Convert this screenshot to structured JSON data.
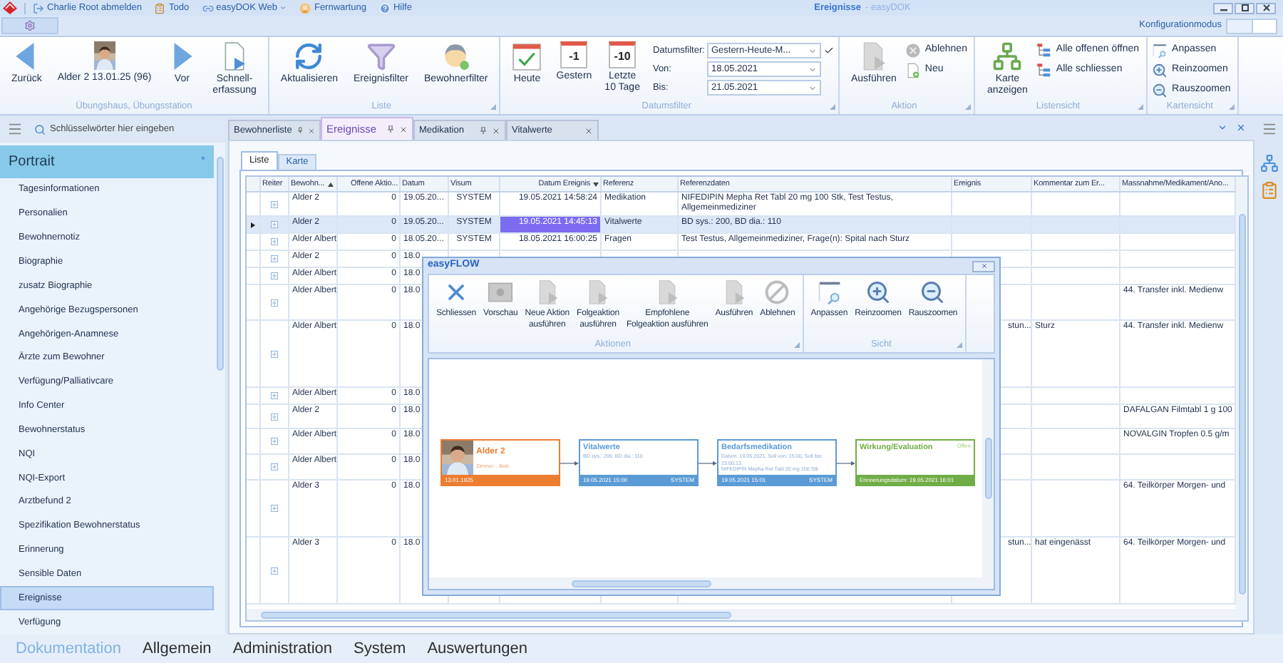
{
  "window": {
    "title": "Ereignisse",
    "subtitle": "- easyDOK"
  },
  "quick_access": [
    {
      "label": "Charlie Root abmelden",
      "kind": "logout",
      "dropdown": false
    },
    {
      "label": "Todo",
      "kind": "todo",
      "dropdown": false
    },
    {
      "label": "easyDOK Web",
      "kind": "link",
      "dropdown": true
    },
    {
      "label": "Fernwartung",
      "kind": "support",
      "dropdown": false
    },
    {
      "label": "Hilfe",
      "kind": "help",
      "dropdown": false
    }
  ],
  "config_mode": {
    "label": "Konfigurationmodus",
    "on": false
  },
  "ribbon": [
    {
      "label": "Übungshaus, Übungsstation",
      "launcher": false,
      "buttons": [
        {
          "lines": [
            "Zurück"
          ],
          "kind": "back"
        },
        {
          "lines": [
            "Alder 2 13.01.25 (96)"
          ]
        },
        {
          "lines": [
            "Vor"
          ],
          "kind": "forward"
        },
        {
          "lines": [
            "Schnell-",
            "erfassung"
          ],
          "kind": "quickentry"
        }
      ]
    },
    {
      "label": "Liste",
      "launcher": true,
      "buttons": [
        {
          "lines": [
            "Aktualisieren"
          ],
          "kind": "refresh"
        },
        {
          "lines": [
            "Ereignisfilter"
          ],
          "kind": "filter"
        },
        {
          "lines": [
            "Bewohnerfilter"
          ],
          "kind": "person"
        }
      ]
    },
    {
      "label": "Datumsfilter",
      "launcher": true,
      "buttons": [
        {
          "lines": [
            "Heute"
          ],
          "kind": "today"
        },
        {
          "lines": [
            "Gestern"
          ],
          "kind": "calendar",
          "badge": "-1"
        },
        {
          "lines": [
            "Letzte",
            "10 Tage"
          ],
          "kind": "calendar",
          "badge": "-10"
        }
      ],
      "fields": [
        {
          "label": "Datumsfilter:",
          "value": "Gestern-Heute-M...",
          "kind": "filter"
        },
        {
          "label": "Von:",
          "value": "18.05.2021",
          "kind": "date"
        },
        {
          "label": "Bis:",
          "value": "21.05.2021",
          "kind": "date"
        }
      ]
    },
    {
      "label": "Aktion",
      "launcher": true,
      "buttons": [
        {
          "lines": [
            "Ausführen"
          ],
          "kind": "doc-play"
        }
      ],
      "small_buttons": [
        {
          "label": "Ablehnen",
          "kind": "reject"
        },
        {
          "label": "Neu",
          "kind": "new"
        }
      ]
    },
    {
      "label": "Listensicht",
      "launcher": true,
      "buttons": [
        {
          "lines": [
            "Karte",
            "anzeigen"
          ],
          "kind": "map"
        }
      ],
      "small_buttons": [
        {
          "label": "Alle offenen öffnen",
          "kind": "expand-all"
        },
        {
          "label": "Alle schliessen",
          "kind": "collapse-all"
        }
      ]
    },
    {
      "label": "Kartensicht",
      "launcher": true,
      "small_buttons": [
        {
          "label": "Anpassen",
          "kind": "fit"
        },
        {
          "label": "Reinzoomen",
          "kind": "zoomin"
        },
        {
          "label": "Rauszoomen",
          "kind": "zoomout"
        }
      ]
    }
  ],
  "sidebar": {
    "search_placeholder": "Schlüsselwörter hier eingeben",
    "header": "Portrait",
    "header_mark": "*",
    "items": [
      {
        "label": "Tagesinformationen",
        "selected": false
      },
      {
        "label": "Personalien",
        "selected": false
      },
      {
        "label": "Bewohnernotiz",
        "selected": false
      },
      {
        "label": "Biographie",
        "selected": false
      },
      {
        "label": "zusatz Biographie",
        "selected": false
      },
      {
        "label": "Angehörige Bezugspersonen",
        "selected": false
      },
      {
        "label": "Angehörigen-Anamnese",
        "selected": false
      },
      {
        "label": "Ärzte zum Bewohner",
        "selected": false
      },
      {
        "label": "Verfügung/Palliativcare",
        "selected": false
      },
      {
        "label": "Info Center",
        "selected": false
      },
      {
        "label": "Bewohnerstatus",
        "selected": false
      },
      {
        "label": "NQI",
        "selected": false
      },
      {
        "label": "NQI-Export",
        "selected": false
      },
      {
        "label": "Arztbefund 2",
        "selected": false
      },
      {
        "label": "Spezifikation Bewohnerstatus",
        "selected": false
      },
      {
        "label": "Erinnerung",
        "selected": false
      },
      {
        "label": "Sensible Daten",
        "selected": false
      },
      {
        "label": "Ereignisse",
        "selected": true
      },
      {
        "label": "Verfügung",
        "selected": false
      }
    ]
  },
  "doc_tabs": [
    {
      "label": "Bewohnerliste",
      "selected": false,
      "pinned": true
    },
    {
      "label": "Ereignisse",
      "selected": true,
      "pinned": true
    },
    {
      "label": "Medikation",
      "selected": false,
      "pinned": true
    },
    {
      "label": "Vitalwerte",
      "selected": false,
      "pinned": false
    }
  ],
  "view_tabs": [
    {
      "label": "Liste",
      "selected": true
    },
    {
      "label": "Karte",
      "selected": false
    }
  ],
  "table": {
    "columns": [
      {
        "label": "Reiter",
        "sorted_ascending": false,
        "sorted_descending": false,
        "focused": false
      },
      {
        "label": "Bewohn...",
        "sorted_ascending": true,
        "sorted_descending": false,
        "focused": false
      },
      {
        "label": "Offene Aktio...",
        "sorted_ascending": false,
        "sorted_descending": false,
        "focused": false
      },
      {
        "label": "Datum",
        "sorted_ascending": false,
        "sorted_descending": false,
        "focused": false
      },
      {
        "label": "Visum",
        "sorted_ascending": false,
        "sorted_descending": false,
        "focused": false
      },
      {
        "label": "Datum Ereignis",
        "sorted_ascending": false,
        "sorted_descending": true,
        "focused": true
      },
      {
        "label": "Referenz",
        "sorted_ascending": false,
        "sorted_descending": false,
        "focused": false
      },
      {
        "label": "Referenzdaten",
        "sorted_ascending": false,
        "sorted_descending": false,
        "focused": false
      },
      {
        "label": "Ereignis",
        "sorted_ascending": false,
        "sorted_descending": false,
        "focused": false
      },
      {
        "label": "Kommentar zum Er...",
        "sorted_ascending": false,
        "sorted_descending": false,
        "focused": false
      },
      {
        "label": "Massnahme/Medikament/Ano...",
        "sorted_ascending": false,
        "sorted_descending": false,
        "focused": false
      }
    ],
    "rows": [
      {
        "selected": false,
        "cells": [
          "",
          "Alder 2",
          "0",
          "19.05.20...",
          "SYSTEM",
          "19.05.2021 14:58:24",
          "Medikation",
          "NIFEDIPIN Mepha Ret Tabl 20 mg 100 Stk, Test Testus, Allgemeinmediziner",
          "",
          "",
          ""
        ]
      },
      {
        "selected": true,
        "cells": [
          "",
          "Alder 2",
          "0",
          "19.05.20...",
          "SYSTEM",
          "19.05.2021 14:45:13",
          "Vitalwerte",
          "BD sys.: 200, BD dia.: 110",
          "",
          "",
          ""
        ]
      },
      {
        "selected": false,
        "cells": [
          "",
          "Alder Albert",
          "0",
          "18.05.20...",
          "SYSTEM",
          "18.05.2021 16:00:25",
          "Fragen",
          "Test Testus, Allgemeinmediziner, Frage(n): Spital nach Sturz",
          "",
          "",
          ""
        ]
      },
      {
        "selected": false,
        "cells": [
          "",
          "Alder 2",
          "0",
          "18.0",
          "",
          "",
          "",
          "",
          "",
          "",
          ""
        ]
      },
      {
        "selected": false,
        "cells": [
          "",
          "Alder Albert",
          "0",
          "18.0",
          "",
          "",
          "",
          "",
          "",
          "",
          ""
        ]
      },
      {
        "selected": false,
        "cells": [
          "",
          "Alder Albert",
          "0",
          "18.0",
          "",
          "",
          "",
          "",
          "",
          "",
          "44. Transfer inkl. Medienw"
        ]
      },
      {
        "selected": false,
        "cells": [
          "",
          "Alder Albert",
          "0",
          "18.0",
          "",
          "",
          "",
          "",
          "stun...",
          "Sturz",
          "44. Transfer inkl. Medienw"
        ]
      },
      {
        "selected": false,
        "cells": [
          "",
          "Alder Albert",
          "0",
          "18.0",
          "",
          "",
          "",
          "",
          "",
          "",
          ""
        ]
      },
      {
        "selected": false,
        "cells": [
          "",
          "Alder 2",
          "0",
          "18.0",
          "",
          "",
          "",
          "",
          "",
          "",
          "DAFALGAN Filmtabl 1 g 100"
        ]
      },
      {
        "selected": false,
        "cells": [
          "",
          "Alder Albert",
          "0",
          "18.0",
          "",
          "",
          "",
          "",
          "",
          "",
          "NOVALGIN Tropfen 0.5 g/m"
        ]
      },
      {
        "selected": false,
        "cells": [
          "",
          "Alder Albert",
          "0",
          "18.0",
          "",
          "",
          "",
          "",
          "",
          "",
          ""
        ]
      },
      {
        "selected": false,
        "cells": [
          "",
          "Alder 3",
          "0",
          "18.0",
          "",
          "",
          "",
          "",
          "",
          "",
          "64. Teilkörper Morgen- und"
        ]
      },
      {
        "selected": false,
        "cells": [
          "",
          "Alder 3",
          "0",
          "18.0",
          "",
          "",
          "",
          "",
          "stun...",
          "hat eingenässt",
          "64. Teilkörper Morgen- und"
        ]
      }
    ]
  },
  "flow_dialog": {
    "title": "easyFLOW",
    "groups": [
      {
        "label": "Aktionen",
        "launcher": true,
        "buttons": [
          {
            "lines": [
              "Schliessen"
            ],
            "kind": "close"
          },
          {
            "lines": [
              "Vorschau"
            ],
            "kind": "preview"
          },
          {
            "lines": [
              "Neue Aktion",
              "ausführen"
            ],
            "kind": "doc-play"
          },
          {
            "lines": [
              "Folgeaktion",
              "ausführen"
            ],
            "kind": "doc-play"
          },
          {
            "lines": [
              "Empfohlene",
              "Folgeaktion ausführen"
            ],
            "kind": "doc-play"
          },
          {
            "lines": [
              "Ausführen"
            ],
            "kind": "doc-play"
          },
          {
            "lines": [
              "Ablehnen"
            ],
            "kind": "block"
          }
        ]
      },
      {
        "label": "Sicht",
        "launcher": true,
        "buttons": [
          {
            "lines": [
              "Anpassen"
            ],
            "kind": "fit"
          },
          {
            "lines": [
              "Reinzoomen"
            ],
            "kind": "zoomin"
          },
          {
            "lines": [
              "Rauszoomen"
            ],
            "kind": "zoomout"
          }
        ]
      }
    ],
    "nodes": [
      {
        "kind": "resident",
        "title": "Alder 2",
        "body": [
          "Zimmer: , Bett:"
        ],
        "footer": "13.01.1925",
        "color": "#ed7d31"
      },
      {
        "kind": "step",
        "title": "Vitalwerte",
        "body": [
          "BD sys.: 200, BD dia.: 110"
        ],
        "footer": "19.05.2021 15:00",
        "footer_right": "SYSTEM",
        "color": "#5b9bd5"
      },
      {
        "kind": "step",
        "title": "Bedarfsmedikation",
        "body": [
          "Datum: 19.05.2021, Soll von: 15:00, Soll bis:",
          "15:00:13,",
          "NIFEDIPIN Mepha Ret Tabl 20 mg 100 Stk"
        ],
        "footer": "19.05.2021 15:01",
        "footer_right": "SYSTEM",
        "color": "#5b9bd5"
      },
      {
        "kind": "step",
        "title": "Wirkung/Evaluation",
        "badge": "Offen",
        "footer": "Erinnerungsdatum: 19.05.2021 16:01",
        "color": "#70ad47"
      }
    ]
  },
  "bottom_nav": [
    {
      "label": "Dokumentation",
      "selected": true
    },
    {
      "label": "Allgemein",
      "selected": false
    },
    {
      "label": "Administration",
      "selected": false
    },
    {
      "label": "System",
      "selected": false
    },
    {
      "label": "Auswertungen",
      "selected": false
    }
  ]
}
